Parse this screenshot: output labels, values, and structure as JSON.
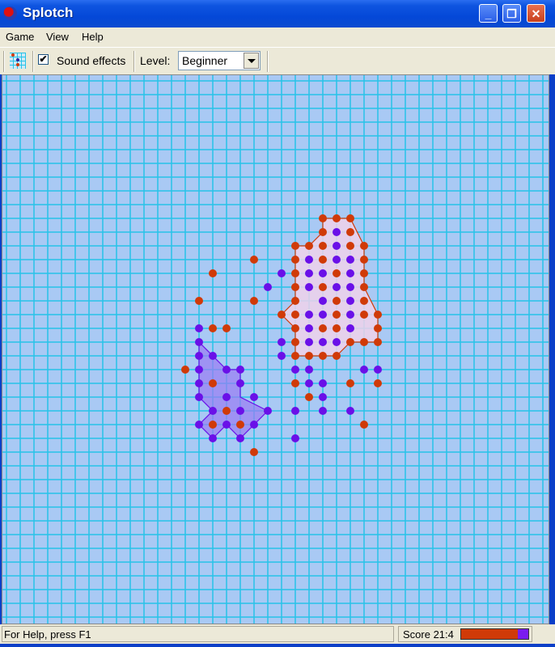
{
  "window": {
    "title": "Splotch",
    "app_icon": "splotch-app-icon"
  },
  "window_controls": {
    "minimize": "_",
    "restore": "❐",
    "close": "✕"
  },
  "menu": [
    "Game",
    "View",
    "Help"
  ],
  "toolbar": {
    "grid_icon": "grid-icon",
    "sound_effects_label": "Sound effects",
    "sound_effects_checked": true,
    "check_mark": "✔",
    "level_label": "Level:",
    "level_value": "Beginner"
  },
  "colors": {
    "board_bg": "#a9c9f4",
    "grid_line": "#27c3e8",
    "red_player": "#d03a08",
    "purple_player": "#6a10e8",
    "red_territory": "#f0d2ea",
    "purple_territory": "#9a7cf2"
  },
  "board": {
    "grid_origin_col_x_ref": 399,
    "pieces": [
      {
        "c": 23,
        "r": 10,
        "p": "R"
      },
      {
        "c": 24,
        "r": 10,
        "p": "R"
      },
      {
        "c": 25,
        "r": 10,
        "p": "R"
      },
      {
        "c": 23,
        "r": 11,
        "p": "R"
      },
      {
        "c": 24,
        "r": 11,
        "p": "P"
      },
      {
        "c": 25,
        "r": 11,
        "p": "R"
      },
      {
        "c": 21,
        "r": 12,
        "p": "R"
      },
      {
        "c": 22,
        "r": 12,
        "p": "R"
      },
      {
        "c": 23,
        "r": 12,
        "p": "R"
      },
      {
        "c": 24,
        "r": 12,
        "p": "P"
      },
      {
        "c": 25,
        "r": 12,
        "p": "R"
      },
      {
        "c": 26,
        "r": 12,
        "p": "R"
      },
      {
        "c": 18,
        "r": 13,
        "p": "R"
      },
      {
        "c": 21,
        "r": 13,
        "p": "R"
      },
      {
        "c": 22,
        "r": 13,
        "p": "P"
      },
      {
        "c": 23,
        "r": 13,
        "p": "R"
      },
      {
        "c": 24,
        "r": 13,
        "p": "P"
      },
      {
        "c": 25,
        "r": 13,
        "p": "P"
      },
      {
        "c": 26,
        "r": 13,
        "p": "R"
      },
      {
        "c": 15,
        "r": 14,
        "p": "R"
      },
      {
        "c": 20,
        "r": 14,
        "p": "P"
      },
      {
        "c": 21,
        "r": 14,
        "p": "R"
      },
      {
        "c": 22,
        "r": 14,
        "p": "P"
      },
      {
        "c": 23,
        "r": 14,
        "p": "P"
      },
      {
        "c": 24,
        "r": 14,
        "p": "R"
      },
      {
        "c": 25,
        "r": 14,
        "p": "P"
      },
      {
        "c": 26,
        "r": 14,
        "p": "R"
      },
      {
        "c": 19,
        "r": 15,
        "p": "P"
      },
      {
        "c": 21,
        "r": 15,
        "p": "R"
      },
      {
        "c": 22,
        "r": 15,
        "p": "P"
      },
      {
        "c": 23,
        "r": 15,
        "p": "R"
      },
      {
        "c": 24,
        "r": 15,
        "p": "P"
      },
      {
        "c": 25,
        "r": 15,
        "p": "P"
      },
      {
        "c": 26,
        "r": 15,
        "p": "R"
      },
      {
        "c": 14,
        "r": 16,
        "p": "R"
      },
      {
        "c": 18,
        "r": 16,
        "p": "R"
      },
      {
        "c": 21,
        "r": 16,
        "p": "R"
      },
      {
        "c": 23,
        "r": 16,
        "p": "P"
      },
      {
        "c": 24,
        "r": 16,
        "p": "R"
      },
      {
        "c": 25,
        "r": 16,
        "p": "P"
      },
      {
        "c": 26,
        "r": 16,
        "p": "R"
      },
      {
        "c": 20,
        "r": 17,
        "p": "R"
      },
      {
        "c": 21,
        "r": 17,
        "p": "R"
      },
      {
        "c": 22,
        "r": 17,
        "p": "P"
      },
      {
        "c": 23,
        "r": 17,
        "p": "P"
      },
      {
        "c": 24,
        "r": 17,
        "p": "R"
      },
      {
        "c": 25,
        "r": 17,
        "p": "P"
      },
      {
        "c": 26,
        "r": 17,
        "p": "R"
      },
      {
        "c": 27,
        "r": 17,
        "p": "R"
      },
      {
        "c": 14,
        "r": 18,
        "p": "P"
      },
      {
        "c": 15,
        "r": 18,
        "p": "R"
      },
      {
        "c": 16,
        "r": 18,
        "p": "R"
      },
      {
        "c": 21,
        "r": 18,
        "p": "R"
      },
      {
        "c": 22,
        "r": 18,
        "p": "P"
      },
      {
        "c": 23,
        "r": 18,
        "p": "R"
      },
      {
        "c": 24,
        "r": 18,
        "p": "R"
      },
      {
        "c": 25,
        "r": 18,
        "p": "P"
      },
      {
        "c": 27,
        "r": 18,
        "p": "R"
      },
      {
        "c": 14,
        "r": 19,
        "p": "P"
      },
      {
        "c": 20,
        "r": 19,
        "p": "P"
      },
      {
        "c": 21,
        "r": 19,
        "p": "R"
      },
      {
        "c": 22,
        "r": 19,
        "p": "P"
      },
      {
        "c": 23,
        "r": 19,
        "p": "P"
      },
      {
        "c": 24,
        "r": 19,
        "p": "P"
      },
      {
        "c": 25,
        "r": 19,
        "p": "R"
      },
      {
        "c": 26,
        "r": 19,
        "p": "R"
      },
      {
        "c": 27,
        "r": 19,
        "p": "R"
      },
      {
        "c": 14,
        "r": 20,
        "p": "P"
      },
      {
        "c": 15,
        "r": 20,
        "p": "P"
      },
      {
        "c": 20,
        "r": 20,
        "p": "P"
      },
      {
        "c": 21,
        "r": 20,
        "p": "R"
      },
      {
        "c": 22,
        "r": 20,
        "p": "R"
      },
      {
        "c": 23,
        "r": 20,
        "p": "R"
      },
      {
        "c": 24,
        "r": 20,
        "p": "R"
      },
      {
        "c": 13,
        "r": 21,
        "p": "R"
      },
      {
        "c": 14,
        "r": 21,
        "p": "P"
      },
      {
        "c": 16,
        "r": 21,
        "p": "P"
      },
      {
        "c": 17,
        "r": 21,
        "p": "P"
      },
      {
        "c": 21,
        "r": 21,
        "p": "P"
      },
      {
        "c": 22,
        "r": 21,
        "p": "P"
      },
      {
        "c": 26,
        "r": 21,
        "p": "P"
      },
      {
        "c": 27,
        "r": 21,
        "p": "P"
      },
      {
        "c": 14,
        "r": 22,
        "p": "P"
      },
      {
        "c": 15,
        "r": 22,
        "p": "R"
      },
      {
        "c": 17,
        "r": 22,
        "p": "P"
      },
      {
        "c": 21,
        "r": 22,
        "p": "R"
      },
      {
        "c": 22,
        "r": 22,
        "p": "P"
      },
      {
        "c": 23,
        "r": 22,
        "p": "P"
      },
      {
        "c": 25,
        "r": 22,
        "p": "R"
      },
      {
        "c": 27,
        "r": 22,
        "p": "R"
      },
      {
        "c": 14,
        "r": 23,
        "p": "P"
      },
      {
        "c": 16,
        "r": 23,
        "p": "P"
      },
      {
        "c": 18,
        "r": 23,
        "p": "P"
      },
      {
        "c": 22,
        "r": 23,
        "p": "R"
      },
      {
        "c": 23,
        "r": 23,
        "p": "P"
      },
      {
        "c": 15,
        "r": 24,
        "p": "P"
      },
      {
        "c": 16,
        "r": 24,
        "p": "R"
      },
      {
        "c": 17,
        "r": 24,
        "p": "P"
      },
      {
        "c": 19,
        "r": 24,
        "p": "P"
      },
      {
        "c": 21,
        "r": 24,
        "p": "P"
      },
      {
        "c": 23,
        "r": 24,
        "p": "P"
      },
      {
        "c": 25,
        "r": 24,
        "p": "P"
      },
      {
        "c": 14,
        "r": 25,
        "p": "P"
      },
      {
        "c": 15,
        "r": 25,
        "p": "R"
      },
      {
        "c": 16,
        "r": 25,
        "p": "P"
      },
      {
        "c": 17,
        "r": 25,
        "p": "R"
      },
      {
        "c": 18,
        "r": 25,
        "p": "P"
      },
      {
        "c": 26,
        "r": 25,
        "p": "R"
      },
      {
        "c": 15,
        "r": 26,
        "p": "P"
      },
      {
        "c": 17,
        "r": 26,
        "p": "P"
      },
      {
        "c": 21,
        "r": 26,
        "p": "P"
      },
      {
        "c": 18,
        "r": 27,
        "p": "R"
      }
    ],
    "territories": [
      {
        "owner": "R",
        "points": [
          [
            23,
            10
          ],
          [
            25,
            10
          ],
          [
            26,
            12
          ],
          [
            26,
            15
          ],
          [
            27,
            17
          ],
          [
            27,
            19
          ],
          [
            25,
            19
          ],
          [
            24,
            20
          ],
          [
            21,
            20
          ],
          [
            21,
            18
          ],
          [
            20,
            17
          ],
          [
            21,
            16
          ],
          [
            21,
            12
          ],
          [
            22,
            12
          ],
          [
            23,
            11
          ]
        ]
      },
      {
        "owner": "P",
        "points": [
          [
            14,
            19
          ],
          [
            16,
            21
          ],
          [
            17,
            21
          ],
          [
            17,
            23
          ],
          [
            19,
            24
          ],
          [
            17,
            26
          ],
          [
            16,
            25
          ],
          [
            15,
            26
          ],
          [
            14,
            25
          ],
          [
            15,
            24
          ],
          [
            14,
            23
          ]
        ]
      }
    ]
  },
  "status": {
    "help_text": "For Help, press F1",
    "score_text": "Score 21:4",
    "score_red": 21,
    "score_purple": 4
  }
}
